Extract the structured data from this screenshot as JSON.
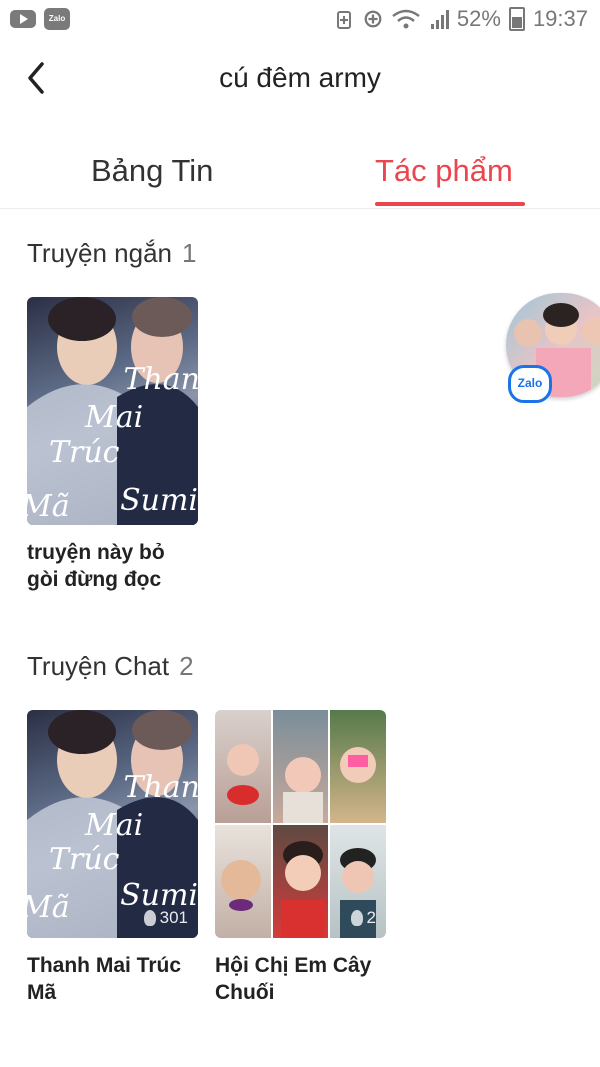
{
  "status_bar": {
    "battery": "52%",
    "time": "19:37"
  },
  "header": {
    "title": "cú đêm army"
  },
  "tabs": [
    {
      "label": "Bảng Tin",
      "active": false
    },
    {
      "label": "Tác phẩm",
      "active": true
    }
  ],
  "sections": [
    {
      "title": "Truyện ngắn",
      "count": "1",
      "items": [
        {
          "title": "truyện này bỏ gòi đừng đọc",
          "overlay": [
            "Than",
            "Mai",
            "Trúc",
            "Mã",
            "Sumi"
          ]
        }
      ]
    },
    {
      "title": "Truyện Chat",
      "count": "2",
      "items": [
        {
          "title": "Thanh Mai Trúc Mã",
          "views": "301",
          "overlay": [
            "Than",
            "Mai",
            "Trúc",
            "Mã",
            "Sumi"
          ]
        },
        {
          "title": "Hội Chị Em Cây Chuối",
          "views": "2"
        }
      ]
    }
  ],
  "floating": {
    "badge": "Zalo"
  },
  "colors": {
    "accent": "#e9474d",
    "text": "#222222"
  },
  "icons": [
    "youtube-icon",
    "zalo-icon",
    "back-arrow-icon",
    "flame-icon",
    "wifi-icon",
    "signal-icon",
    "battery-icon"
  ]
}
